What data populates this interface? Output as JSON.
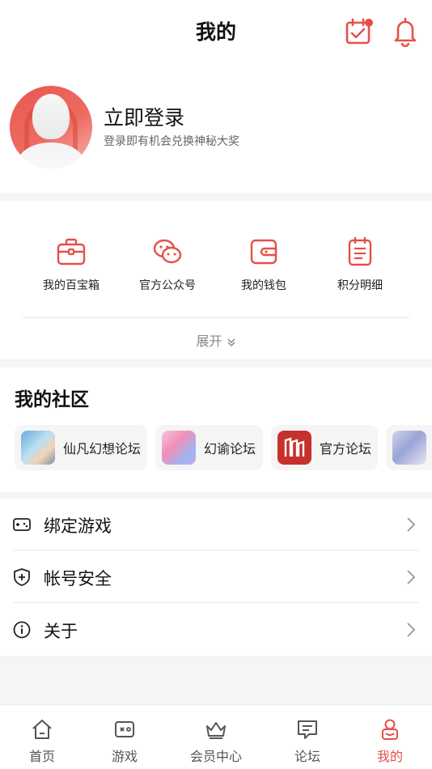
{
  "header": {
    "title": "我的"
  },
  "profile": {
    "login_label": "立即登录",
    "subtitle": "登录即有机会兑换神秘大奖"
  },
  "tools": {
    "items": [
      {
        "label": "我的百宝箱",
        "icon": "toolbox-icon"
      },
      {
        "label": "官方公众号",
        "icon": "wechat-icon"
      },
      {
        "label": "我的钱包",
        "icon": "wallet-icon"
      },
      {
        "label": "积分明细",
        "icon": "points-list-icon"
      }
    ],
    "expand_label": "展开"
  },
  "community": {
    "title": "我的社区",
    "forums": [
      {
        "name": "仙凡幻想论坛"
      },
      {
        "name": "幻谕论坛"
      },
      {
        "name": "官方论坛"
      },
      {
        "name": ""
      }
    ]
  },
  "menu": {
    "items": [
      {
        "label": "绑定游戏",
        "icon": "gamepad-icon"
      },
      {
        "label": "帐号安全",
        "icon": "shield-icon"
      },
      {
        "label": "关于",
        "icon": "info-icon"
      }
    ]
  },
  "tabbar": {
    "items": [
      {
        "label": "首页",
        "icon": "home-icon",
        "active": false
      },
      {
        "label": "游戏",
        "icon": "game-icon",
        "active": false
      },
      {
        "label": "会员中心",
        "icon": "crown-icon",
        "active": false
      },
      {
        "label": "论坛",
        "icon": "forum-icon",
        "active": false
      },
      {
        "label": "我的",
        "icon": "me-icon",
        "active": true
      }
    ]
  },
  "colors": {
    "accent": "#e5504a",
    "background": "#f5f5f7"
  }
}
